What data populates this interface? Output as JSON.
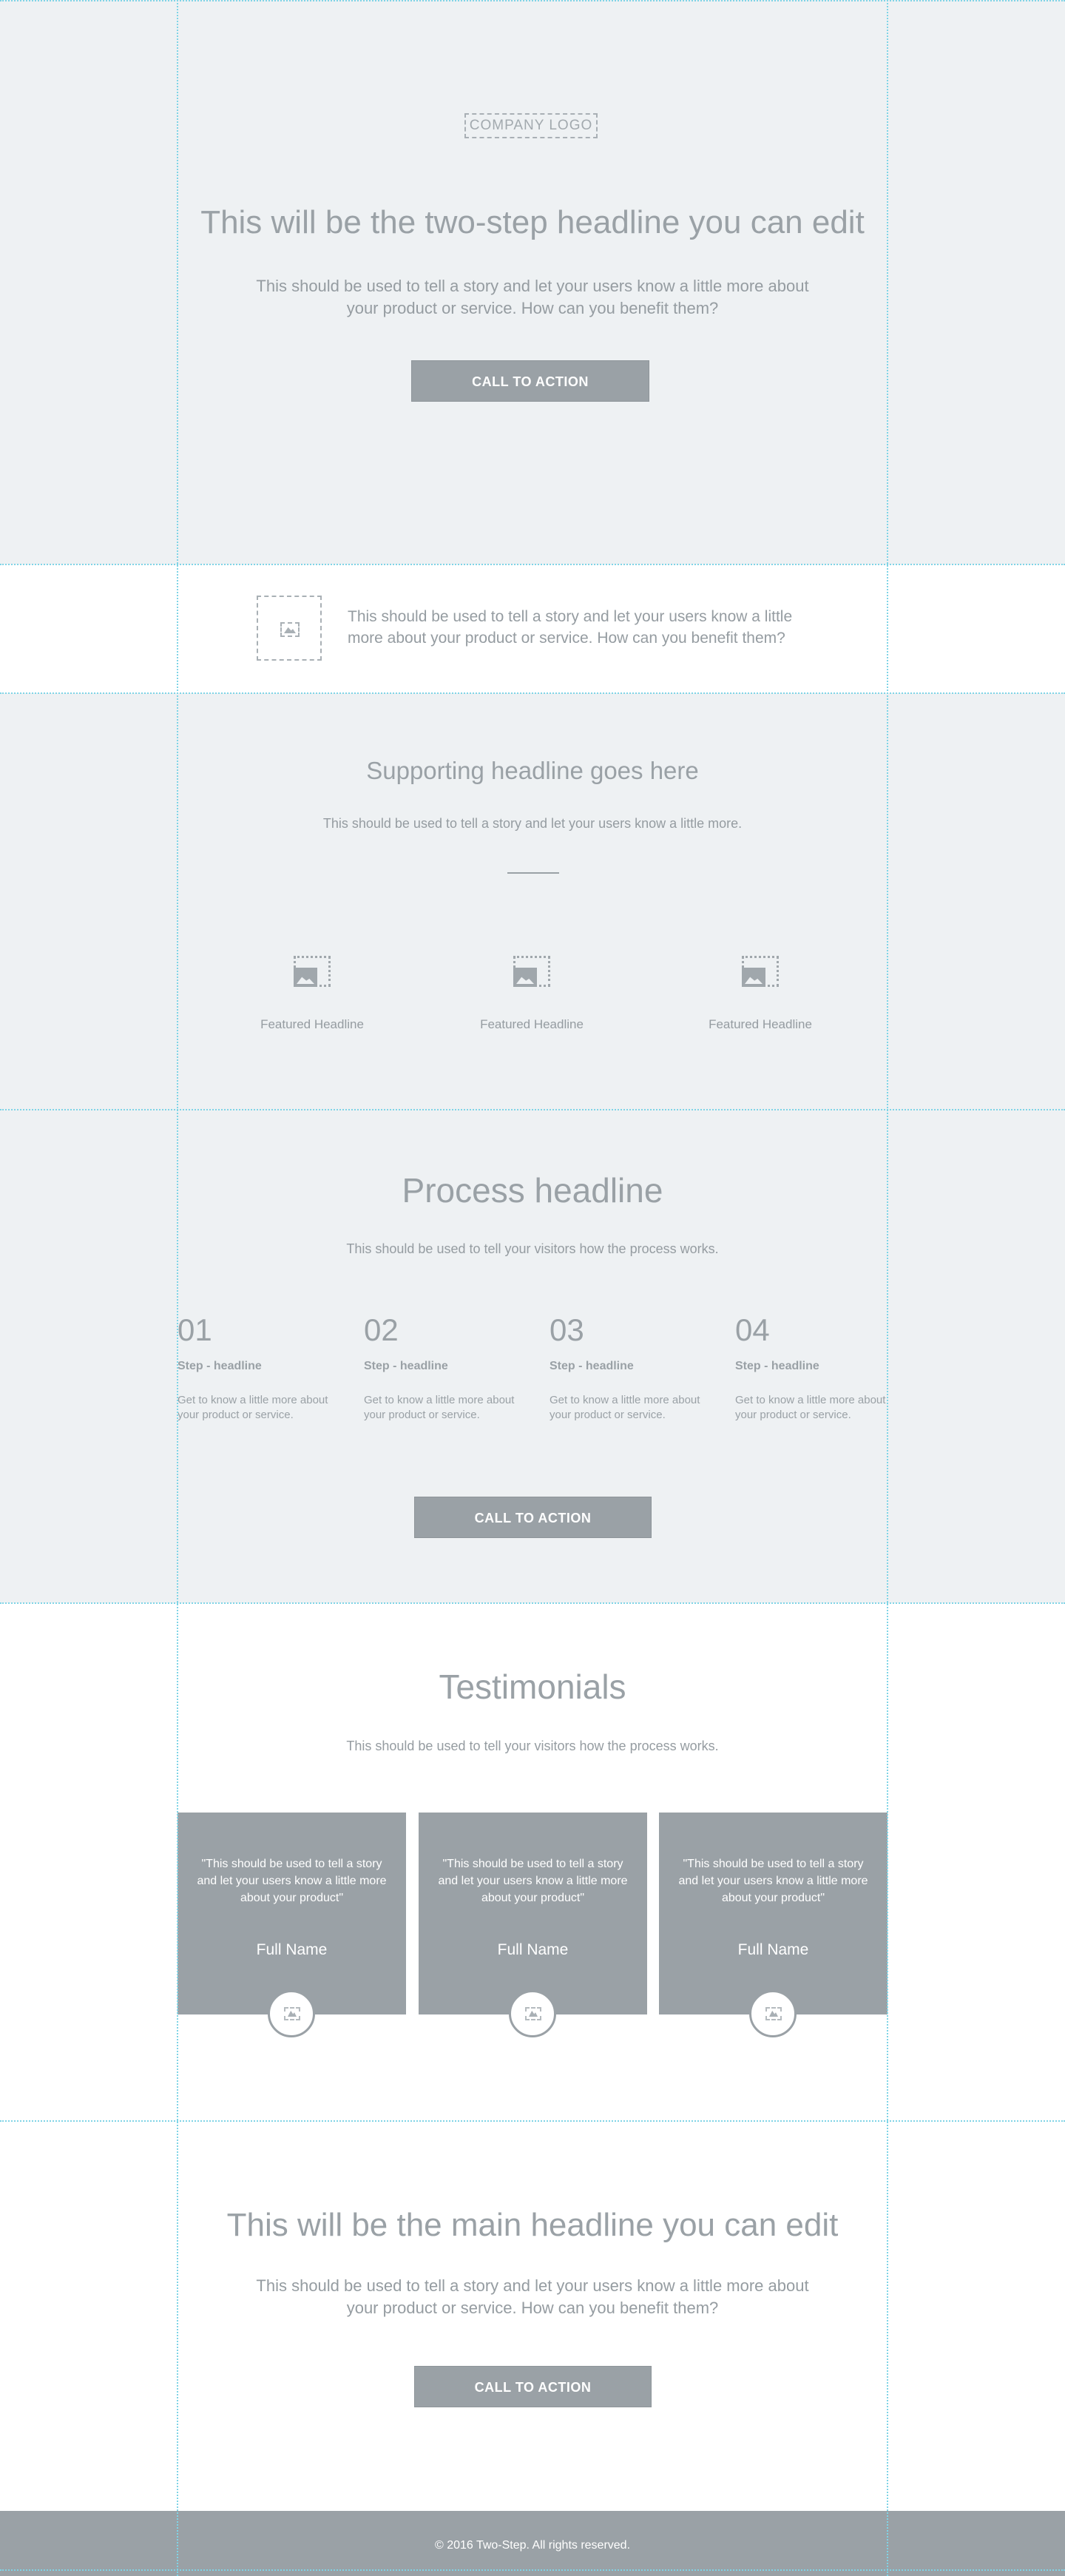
{
  "hero": {
    "logo": "COMPANY LOGO",
    "headline": "This will be the two-step headline you can edit",
    "body": "This should be used to tell a story and let your users know a little more about your product or service. How can you benefit them?",
    "cta": "CALL TO ACTION"
  },
  "intro": {
    "text": "This should be used to tell a story and let your users know a little more about your product or service. How can you benefit them?"
  },
  "features": {
    "headline": "Supporting headline goes here",
    "body": "This should be used to tell a story and let your users know a little more.",
    "items": [
      {
        "label": "Featured Headline"
      },
      {
        "label": "Featured Headline"
      },
      {
        "label": "Featured Headline"
      }
    ]
  },
  "process": {
    "headline": "Process headline",
    "body": "This should be used to tell your visitors how the process works.",
    "steps": [
      {
        "num": "01",
        "title": "Step - headline",
        "text": "Get to know a little more about your product or service."
      },
      {
        "num": "02",
        "title": "Step - headline",
        "text": "Get to know a little more about your product or service."
      },
      {
        "num": "03",
        "title": "Step - headline",
        "text": "Get to know a little more about your product or service."
      },
      {
        "num": "04",
        "title": "Step - headline",
        "text": "Get to know a little more about your product or service."
      }
    ],
    "cta": "CALL TO ACTION"
  },
  "testimonials": {
    "headline": "Testimonials",
    "body": "This should be used to tell your visitors how the process works.",
    "cards": [
      {
        "quote": "\"This should be used to tell a story and let your users know a little more about your product\"",
        "name": "Full Name"
      },
      {
        "quote": "\"This should be used to tell a story and let your users know a little more about your product\"",
        "name": "Full Name"
      },
      {
        "quote": "\"This should be used to tell a story and let your users know a little more about your product\"",
        "name": "Full Name"
      }
    ]
  },
  "main_cta": {
    "headline": "This will be the main headline you can edit",
    "body": "This should be used to tell a story and let your users know a little more about your product or service. How can you benefit them?",
    "cta": "CALL TO ACTION"
  },
  "footer": {
    "text": "© 2016 Two-Step. All rights reserved."
  },
  "colors": {
    "section_gray": "#eef1f3",
    "accent_gray": "#9aa1a6",
    "guide": "#7fd4e6"
  }
}
